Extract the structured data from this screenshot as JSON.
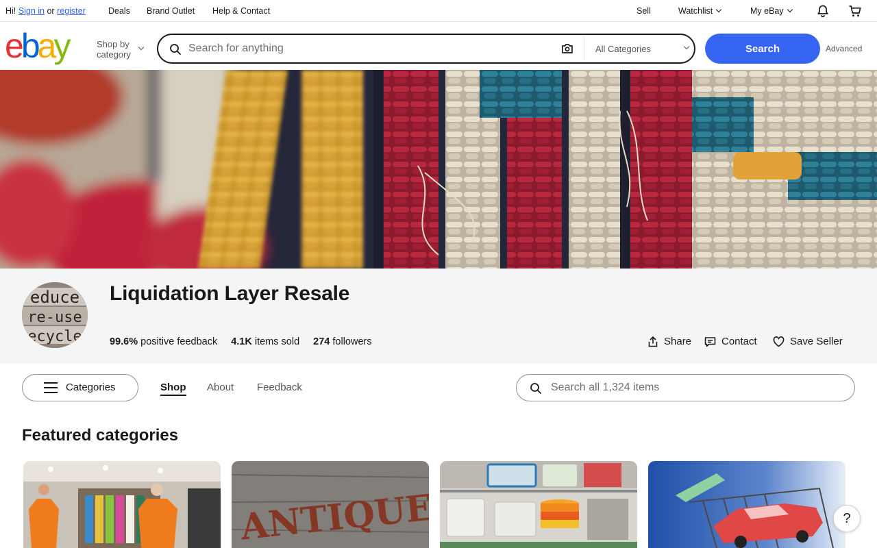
{
  "topbar": {
    "greeting": "Hi!",
    "sign_in": "Sign in",
    "or": "or",
    "register": "register",
    "deals": "Deals",
    "brand_outlet": "Brand Outlet",
    "help_contact": "Help & Contact",
    "sell": "Sell",
    "watchlist": "Watchlist",
    "my_ebay": "My eBay",
    "icons": [
      "bell-icon",
      "cart-icon"
    ]
  },
  "header": {
    "logo_letters": [
      "e",
      "b",
      "a",
      "y"
    ],
    "logo_colors": [
      "#e53238",
      "#0064d2",
      "#f5af02",
      "#86b817"
    ],
    "shop_by_line1": "Shop by",
    "shop_by_line2": "category",
    "search_placeholder": "Search for anything",
    "category_select": "All Categories",
    "search_button": "Search",
    "advanced": "Advanced",
    "accent_color": "#3665f3"
  },
  "store": {
    "name": "Liquidation Layer Resale",
    "avatar_text": [
      "educe",
      "re-use",
      "ecycle"
    ],
    "feedback_value": "99.6%",
    "feedback_label": "positive feedback",
    "sold_value": "4.1K",
    "sold_label": "items sold",
    "followers_value": "274",
    "followers_label": "followers",
    "share": "Share",
    "contact": "Contact",
    "save_seller": "Save Seller"
  },
  "store_nav": {
    "categories_button": "Categories",
    "tabs": [
      "Shop",
      "About",
      "Feedback"
    ],
    "active_tab": "Shop",
    "search_placeholder": "Search all 1,324 items"
  },
  "featured": {
    "title": "Featured categories",
    "tiles": [
      "clothing-store-image",
      "antiques-image",
      "storage-bins-image",
      "toy-car-image"
    ],
    "antiques_text": "ANTIQUES"
  },
  "help_button": "?"
}
